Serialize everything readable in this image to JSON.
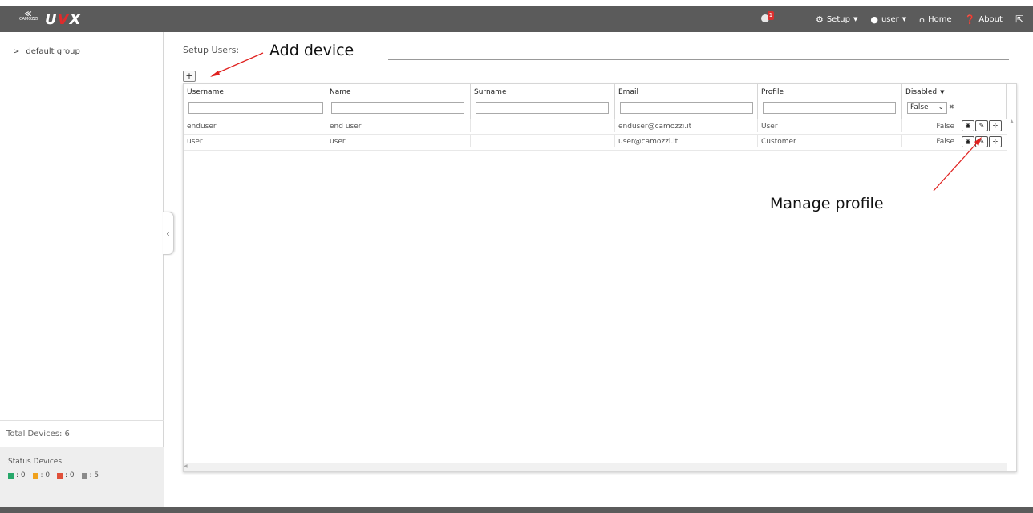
{
  "app": {
    "brand_small": "CAMOZZI",
    "brand_name_pre": "U",
    "brand_name_accent": "V",
    "brand_name_post": "X"
  },
  "notifications": {
    "count": "1",
    "icon": "globe-icon"
  },
  "nav": {
    "setup": "Setup",
    "user": "user",
    "home": "Home",
    "about": "About"
  },
  "sidebar": {
    "tree_item": "default group",
    "total_devices": "Total Devices: 6",
    "status_title": "Status Devices:",
    "status_counts": [
      {
        "color": "#27a86a",
        "value": ": 0"
      },
      {
        "color": "#f0a11c",
        "value": ": 0"
      },
      {
        "color": "#e0503a",
        "value": ": 0"
      },
      {
        "color": "#8a8a8a",
        "value": ": 5"
      }
    ]
  },
  "main": {
    "title": "Setup Users:",
    "columns": [
      "Username",
      "Name",
      "Surname",
      "Email",
      "Profile",
      "Disabled"
    ],
    "disabled_filter": "False",
    "rows": [
      {
        "username": "enduser",
        "name": "end user",
        "surname": "",
        "email": "enduser@camozzi.it",
        "profile": "User",
        "disabled": "False"
      },
      {
        "username": "user",
        "name": "user",
        "surname": "",
        "email": "user@camozzi.it",
        "profile": "Customer",
        "disabled": "False"
      }
    ]
  },
  "annotations": {
    "add_device": "Add device",
    "manage_profile": "Manage profile"
  }
}
